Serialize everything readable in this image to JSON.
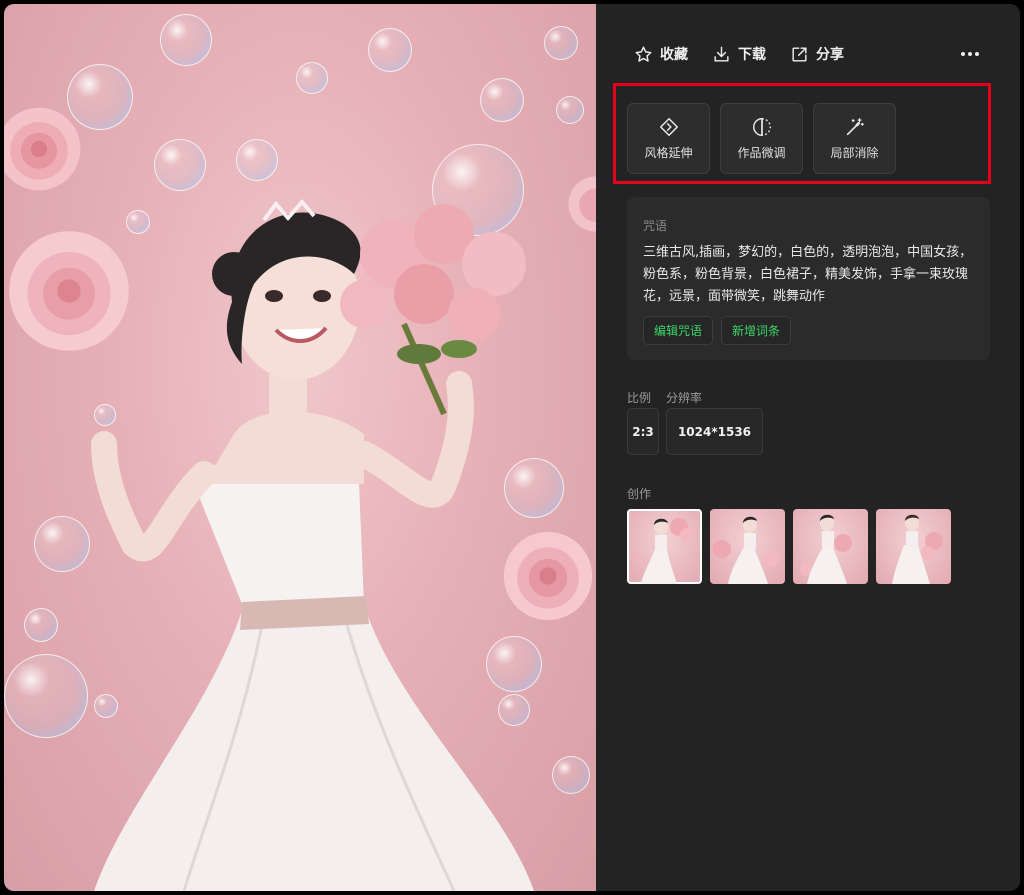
{
  "toolbar": {
    "favorite_label": "收藏",
    "download_label": "下载",
    "share_label": "分享"
  },
  "tools": [
    {
      "label": "风格延伸",
      "icon": "diamond-arrow-icon"
    },
    {
      "label": "作品微调",
      "icon": "half-circle-icon"
    },
    {
      "label": "局部消除",
      "icon": "magic-wand-icon"
    }
  ],
  "prompt": {
    "title": "咒语",
    "text": "三维古风,插画，梦幻的，白色的，透明泡泡，中国女孩，粉色系，粉色背景，白色裙子，精美发饰，手拿一束玫瑰花，远景，面带微笑，跳舞动作",
    "edit_label": "编辑咒语",
    "add_label": "新增词条"
  },
  "meta": {
    "ratio_label": "比例",
    "ratio_value": "2:3",
    "resolution_label": "分辨率",
    "resolution_value": "1024*1536"
  },
  "creation": {
    "label": "创作",
    "thumbnails": 4,
    "selected_index": 0
  },
  "colors": {
    "highlight": "#e3001b",
    "accent_green": "#3bd66a",
    "panel_bg": "#232323"
  }
}
